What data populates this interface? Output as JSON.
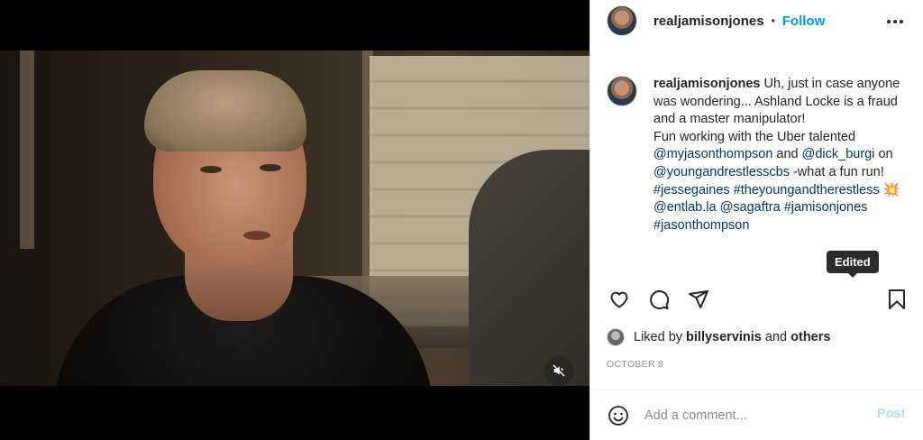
{
  "post": {
    "username": "realjamisonjones",
    "dot": "•",
    "follow_label": "Follow",
    "more_icon": "ellipsis-icon"
  },
  "caption": {
    "username": "realjamisonjones",
    "line1": "Uh, just in case anyone was wondering... Ashland Locke is a fraud and a master manipulator!",
    "line2a": "Fun working with the Uber talented ",
    "mention1": "@myjasonthompson",
    "and1": " and ",
    "mention2": "@dick_burgi",
    "on": " on ",
    "mention3": "@youngandrestlesscbs",
    "line3": " -what a fun run! ",
    "tag1": "#jessegaines",
    "tag2": "#theyoungandtherestless",
    "emoji": "💥",
    "mention4": "@entlab.la",
    "mention5": "@sagaftra",
    "tag3": "#jamisonjones",
    "tag4": "#jasonthompson"
  },
  "tooltip": "Edited",
  "likes": {
    "prefix": "Liked by ",
    "user": "billyservinis",
    "middle": " and ",
    "others": "others"
  },
  "date": "OCTOBER 8",
  "comment": {
    "placeholder": "Add a comment...",
    "post_label": "Post"
  },
  "colors": {
    "follow": "#0095f6",
    "link": "#00376b",
    "post_disabled": "#b2dffc"
  }
}
